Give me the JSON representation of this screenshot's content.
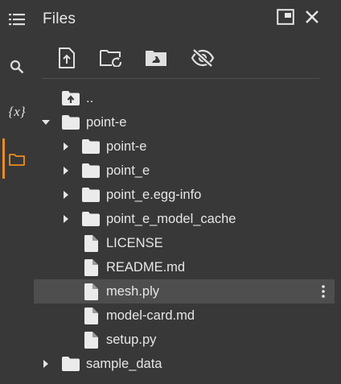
{
  "sidebar": {
    "items": [
      {
        "name": "table-of-contents-icon"
      },
      {
        "name": "search-icon"
      },
      {
        "name": "variables-icon",
        "label": "{x}"
      },
      {
        "name": "files-icon"
      }
    ],
    "active_index": 3,
    "active_color": "#f08c1b"
  },
  "panel": {
    "title": "Files",
    "window_buttons": [
      {
        "name": "open-in-tab-icon"
      },
      {
        "name": "close-icon"
      }
    ],
    "toolbar": [
      {
        "name": "upload-icon"
      },
      {
        "name": "refresh-folder-icon"
      },
      {
        "name": "mount-drive-icon"
      },
      {
        "name": "hide-hidden-files-icon"
      }
    ]
  },
  "tree": [
    {
      "label": "..",
      "icon": "parent-folder-icon",
      "depth": 0,
      "expandable": false
    },
    {
      "label": "point-e",
      "icon": "folder-icon",
      "depth": 0,
      "expandable": true,
      "expanded": true
    },
    {
      "label": "point-e",
      "icon": "folder-icon",
      "depth": 1,
      "expandable": true,
      "expanded": false
    },
    {
      "label": "point_e",
      "icon": "folder-icon",
      "depth": 1,
      "expandable": true,
      "expanded": false
    },
    {
      "label": "point_e.egg-info",
      "icon": "folder-icon",
      "depth": 1,
      "expandable": true,
      "expanded": false
    },
    {
      "label": "point_e_model_cache",
      "icon": "folder-icon",
      "depth": 1,
      "expandable": true,
      "expanded": false
    },
    {
      "label": "LICENSE",
      "icon": "file-icon",
      "depth": 1,
      "expandable": false
    },
    {
      "label": "README.md",
      "icon": "file-icon",
      "depth": 1,
      "expandable": false
    },
    {
      "label": "mesh.ply",
      "icon": "file-icon",
      "depth": 1,
      "expandable": false,
      "selected": true
    },
    {
      "label": "model-card.md",
      "icon": "file-icon",
      "depth": 1,
      "expandable": false
    },
    {
      "label": "setup.py",
      "icon": "file-icon",
      "depth": 1,
      "expandable": false
    },
    {
      "label": "sample_data",
      "icon": "folder-icon",
      "depth": 0,
      "expandable": true,
      "expanded": false
    }
  ]
}
